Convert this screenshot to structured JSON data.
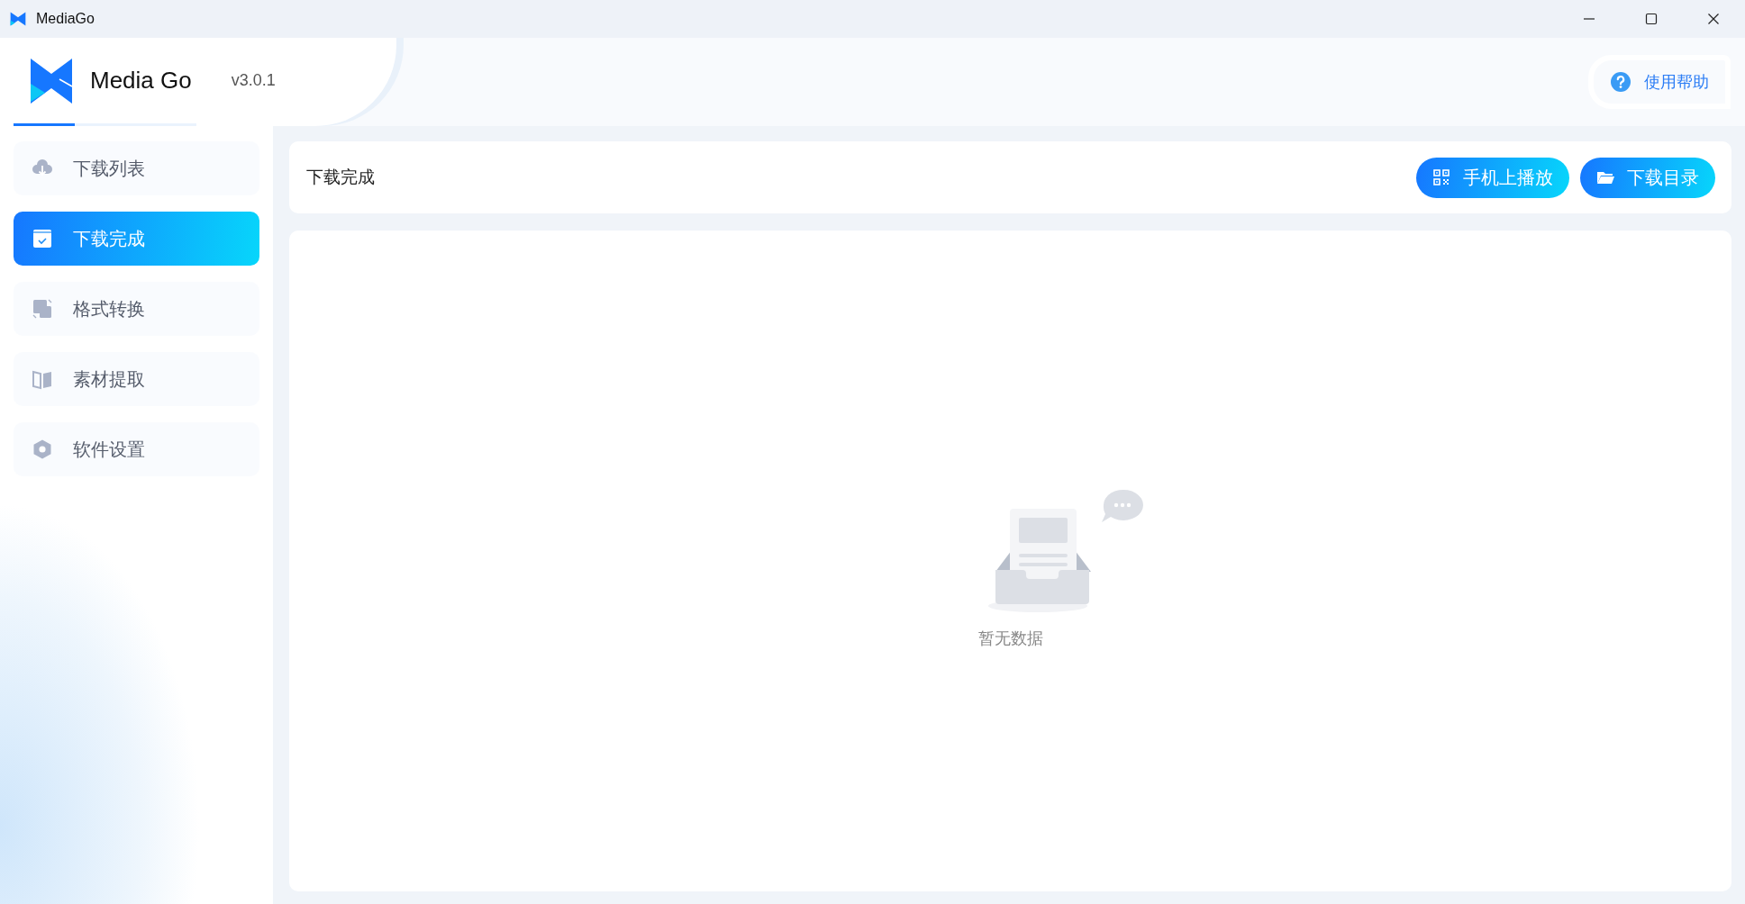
{
  "window": {
    "title": "MediaGo"
  },
  "header": {
    "app_name": "Media Go",
    "version": "v3.0.1",
    "help_button": "使用帮助"
  },
  "sidebar": {
    "items": [
      {
        "label": "下载列表",
        "selected": false
      },
      {
        "label": "下载完成",
        "selected": true
      },
      {
        "label": "格式转换",
        "selected": false
      },
      {
        "label": "素材提取",
        "selected": false
      },
      {
        "label": "软件设置",
        "selected": false
      }
    ]
  },
  "toolbar": {
    "title": "下载完成",
    "buttons": [
      {
        "label": "手机上播放"
      },
      {
        "label": "下载目录"
      }
    ]
  },
  "empty_state": {
    "text": "暂无数据"
  }
}
